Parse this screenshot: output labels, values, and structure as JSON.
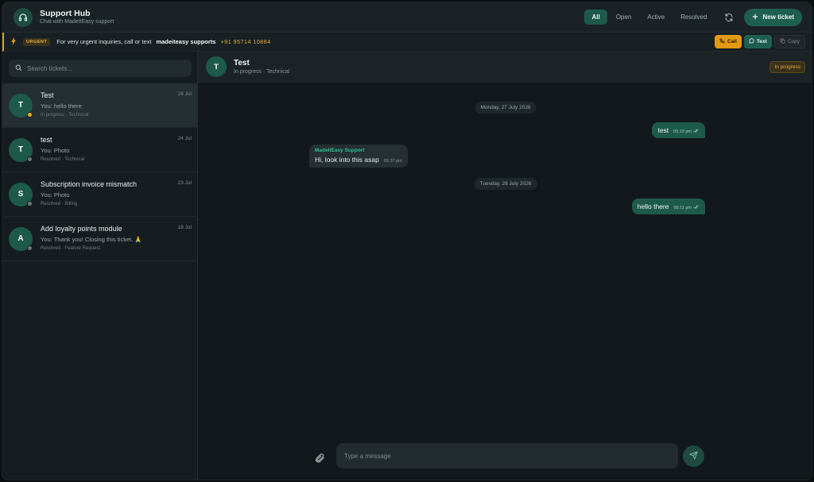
{
  "header": {
    "title": "Support Hub",
    "subtitle": "Chat with MadeItEasy support",
    "filters": [
      "All",
      "Open",
      "Active",
      "Resolved"
    ],
    "active_filter": "All",
    "new_ticket_label": "New ticket",
    "icons": {
      "logo": "headset-icon",
      "refresh": "refresh-icon",
      "new": "plus-icon"
    }
  },
  "urgent": {
    "badge": "URGENT",
    "text": "For very urgent inquiries, call or text",
    "name": "madeiteasy supports",
    "phone": "+91 95714 10884",
    "call_label": "Call",
    "text_label": "Text",
    "copy_label": "Copy"
  },
  "sidebar": {
    "search_placeholder": "Search tickets...",
    "tickets": [
      {
        "initial": "T",
        "title": "Test",
        "preview": "You: hello there",
        "meta": "In progress · Technical",
        "date": "28 Jul",
        "status": "progress"
      },
      {
        "initial": "T",
        "title": "test",
        "preview": "You: Photo",
        "meta": "Resolved · Technical",
        "date": "24 Jul",
        "status": "resolved"
      },
      {
        "initial": "S",
        "title": "Subscription invoice mismatch",
        "preview": "You: Photo",
        "meta": "Resolved · Billing",
        "date": "23 Jul",
        "status": "resolved"
      },
      {
        "initial": "A",
        "title": "Add loyalty points module",
        "preview": "You: Thank you! Closing this ticket. 🙏",
        "meta": "Resolved · Feature Request",
        "date": "18 Jul",
        "status": "resolved"
      }
    ]
  },
  "chat": {
    "initial": "T",
    "title": "Test",
    "subtitle": "In progress · Technical",
    "status_badge": "In progress",
    "date_1": "Monday, 27 July 2026",
    "date_2": "Tuesday, 28 July 2026",
    "messages": [
      {
        "text": "test",
        "time": "05:19 pm"
      },
      {
        "sender": "MadeItEasy Support",
        "text": "Hi, look into this asap",
        "time": "05:37 pm"
      },
      {
        "text": "hello there",
        "time": "06:11 pm"
      }
    ],
    "input_placeholder": "Type a message"
  },
  "colors": {
    "accent": "#1e5a49",
    "warning": "#e39a12",
    "support_name": "#2fc18c"
  }
}
